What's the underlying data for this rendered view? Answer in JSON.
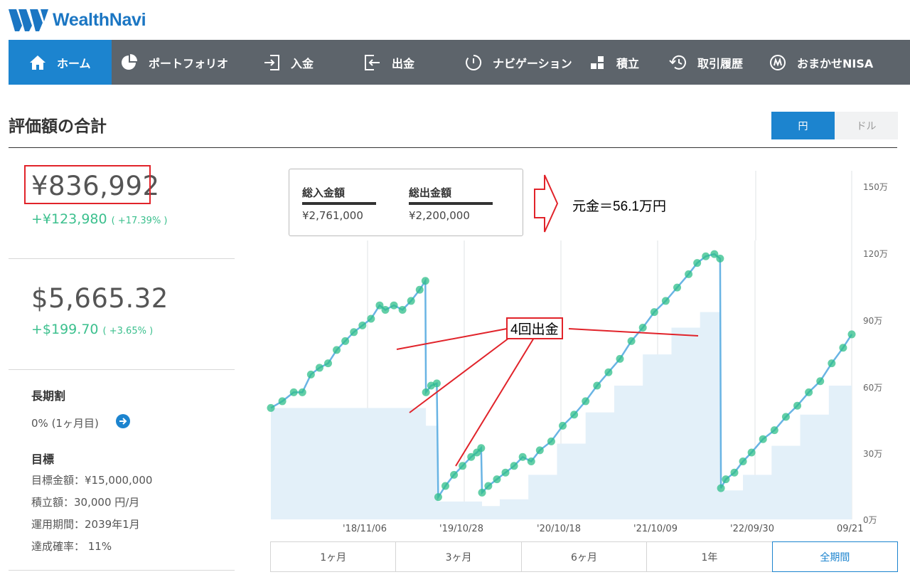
{
  "brand": {
    "name": "WealthNavi"
  },
  "nav": [
    {
      "label": "ホーム",
      "icon": "home-icon",
      "active": true
    },
    {
      "label": "ポートフォリオ",
      "icon": "pie-chart-icon"
    },
    {
      "label": "入金",
      "icon": "deposit-icon"
    },
    {
      "label": "出金",
      "icon": "withdraw-icon"
    },
    {
      "label": "ナビゲーション",
      "icon": "clock-icon"
    },
    {
      "label": "積立",
      "icon": "blocks-icon"
    },
    {
      "label": "取引履歴",
      "icon": "history-icon"
    },
    {
      "label": "おまかせNISA",
      "icon": "nisa-icon"
    }
  ],
  "page": {
    "title": "評価額の合計"
  },
  "currency_toggle": {
    "yen": "円",
    "dollar": "ドル",
    "selected": "円"
  },
  "summary": {
    "yen_total": "¥836,992",
    "yen_gain": "+¥123,980",
    "yen_gain_pct": "( +17.39% )",
    "usd_total": "$5,665.32",
    "usd_gain": "+$199.70",
    "usd_gain_pct": "( +3.65% )"
  },
  "long_term_discount": {
    "heading": "長期割",
    "value": "0% (1ヶ月目)"
  },
  "goal": {
    "heading": "目標",
    "target_amount": "目標金額：¥15,000,000",
    "monthly": "積立額：30,000 円/月",
    "period": "運用期間：2039年1月",
    "probability": "達成確率： 11%"
  },
  "legend": {
    "deposit_label": "総入金額",
    "deposit_value": "¥2,761,000",
    "withdraw_label": "総出金額",
    "withdraw_value": "¥2,200,000"
  },
  "annotations": {
    "principal": "元金＝56.1万円",
    "withdrawals": "4回出金"
  },
  "colors": {
    "accent": "#1c84cf",
    "nav_bg": "#5d646b",
    "gain": "#3cc08e",
    "line": "#69b4e4",
    "area": "#e3f0f9",
    "marker": "#2fbf8a",
    "annotation": "#e1232a"
  },
  "periods": [
    {
      "label": "1ヶ月"
    },
    {
      "label": "3ヶ月"
    },
    {
      "label": "6ヶ月"
    },
    {
      "label": "1年"
    },
    {
      "label": "全期間",
      "active": true
    }
  ],
  "chart_data": {
    "type": "area",
    "y_unit": "万",
    "ylim": [
      0,
      150
    ],
    "y_ticks": [
      "150万",
      "120万",
      "90万",
      "60万",
      "30万",
      "0万"
    ],
    "x_ticks": [
      "'18/11/06",
      "'19/10/28",
      "'20/10/18",
      "'21/10/09",
      "'22/09/30",
      "09/21"
    ],
    "grid": true,
    "series": [
      {
        "points": [
          [
            0,
            50
          ],
          [
            4,
            53
          ],
          [
            8,
            57
          ],
          [
            11,
            57
          ],
          [
            14,
            65
          ],
          [
            17,
            68
          ],
          [
            20,
            70
          ],
          [
            23,
            76
          ],
          [
            26,
            80
          ],
          [
            29,
            84
          ],
          [
            32,
            87
          ],
          [
            35,
            90
          ],
          [
            38,
            96
          ],
          [
            40,
            94
          ],
          [
            43,
            96
          ],
          [
            46,
            94
          ],
          [
            49,
            98
          ],
          [
            52,
            103
          ],
          [
            54,
            107
          ],
          [
            54.2,
            57
          ],
          [
            56,
            60
          ],
          [
            58,
            61
          ],
          [
            58.5,
            10
          ],
          [
            61,
            15
          ],
          [
            64,
            20
          ],
          [
            67,
            24
          ],
          [
            70,
            28
          ],
          [
            72,
            30
          ],
          [
            73.5,
            32
          ],
          [
            73.8,
            12
          ],
          [
            76,
            15
          ],
          [
            79,
            18
          ],
          [
            82,
            21
          ],
          [
            85,
            24
          ],
          [
            88,
            28
          ],
          [
            91,
            26
          ],
          [
            94,
            31
          ],
          [
            98,
            35
          ],
          [
            102,
            42
          ],
          [
            106,
            47
          ],
          [
            110,
            53
          ],
          [
            114,
            60
          ],
          [
            118,
            66
          ],
          [
            122,
            72
          ],
          [
            126,
            80
          ],
          [
            130,
            86
          ],
          [
            134,
            93
          ],
          [
            138,
            98
          ],
          [
            142,
            104
          ],
          [
            146,
            110
          ],
          [
            149,
            115
          ],
          [
            152,
            118
          ],
          [
            155,
            119
          ],
          [
            157,
            117
          ],
          [
            157.3,
            14
          ],
          [
            159,
            18
          ],
          [
            162,
            21
          ],
          [
            165,
            26
          ],
          [
            168,
            30
          ],
          [
            172,
            36
          ],
          [
            176,
            40
          ],
          [
            180,
            46
          ],
          [
            184,
            51
          ],
          [
            188,
            57
          ],
          [
            192,
            62
          ],
          [
            196,
            70
          ],
          [
            200,
            77
          ],
          [
            203,
            83
          ]
        ]
      },
      {
        "type": "step",
        "points": [
          [
            0,
            50
          ],
          [
            54,
            50
          ],
          [
            54.2,
            42
          ],
          [
            58.5,
            8
          ],
          [
            73.8,
            6
          ],
          [
            80,
            9
          ],
          [
            90,
            20
          ],
          [
            100,
            34
          ],
          [
            110,
            48
          ],
          [
            120,
            60
          ],
          [
            130,
            74
          ],
          [
            140,
            86
          ],
          [
            150,
            93
          ],
          [
            157,
            98
          ],
          [
            157.3,
            13
          ],
          [
            165,
            20
          ],
          [
            175,
            33
          ],
          [
            185,
            47
          ],
          [
            195,
            60
          ],
          [
            203,
            70
          ]
        ]
      }
    ]
  }
}
